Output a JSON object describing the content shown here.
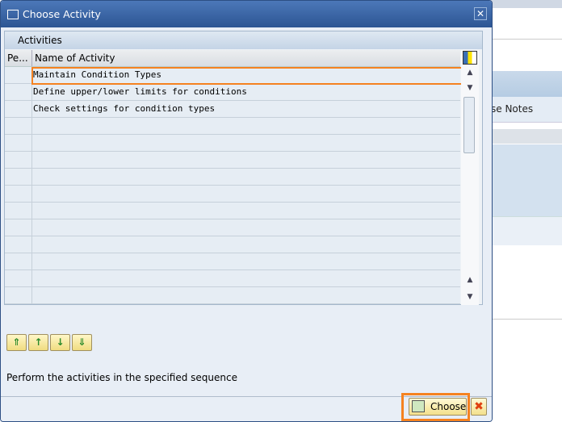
{
  "background": {
    "notes_label": "se Notes"
  },
  "dialog": {
    "title": "Choose Activity",
    "table": {
      "caption": "Activities",
      "columns": [
        "Pe...",
        "Name of Activity"
      ],
      "rows": [
        {
          "pe": "",
          "name": "Maintain Condition Types",
          "selected": true
        },
        {
          "pe": "",
          "name": "Define upper/lower limits for conditions"
        },
        {
          "pe": "",
          "name": "Check settings for condition types"
        },
        {
          "pe": "",
          "name": ""
        },
        {
          "pe": "",
          "name": ""
        },
        {
          "pe": "",
          "name": ""
        },
        {
          "pe": "",
          "name": ""
        },
        {
          "pe": "",
          "name": ""
        },
        {
          "pe": "",
          "name": ""
        },
        {
          "pe": "",
          "name": ""
        },
        {
          "pe": "",
          "name": ""
        },
        {
          "pe": "",
          "name": ""
        },
        {
          "pe": "",
          "name": ""
        },
        {
          "pe": "",
          "name": ""
        }
      ]
    },
    "toolbar_icons": [
      "move-to-top-icon",
      "move-up-icon",
      "move-down-icon",
      "move-to-bottom-icon"
    ],
    "message": "Perform the activities in the specified sequence",
    "buttons": {
      "choose": "Choose",
      "cancel": "✖"
    },
    "highlight_color": "#f58220"
  }
}
